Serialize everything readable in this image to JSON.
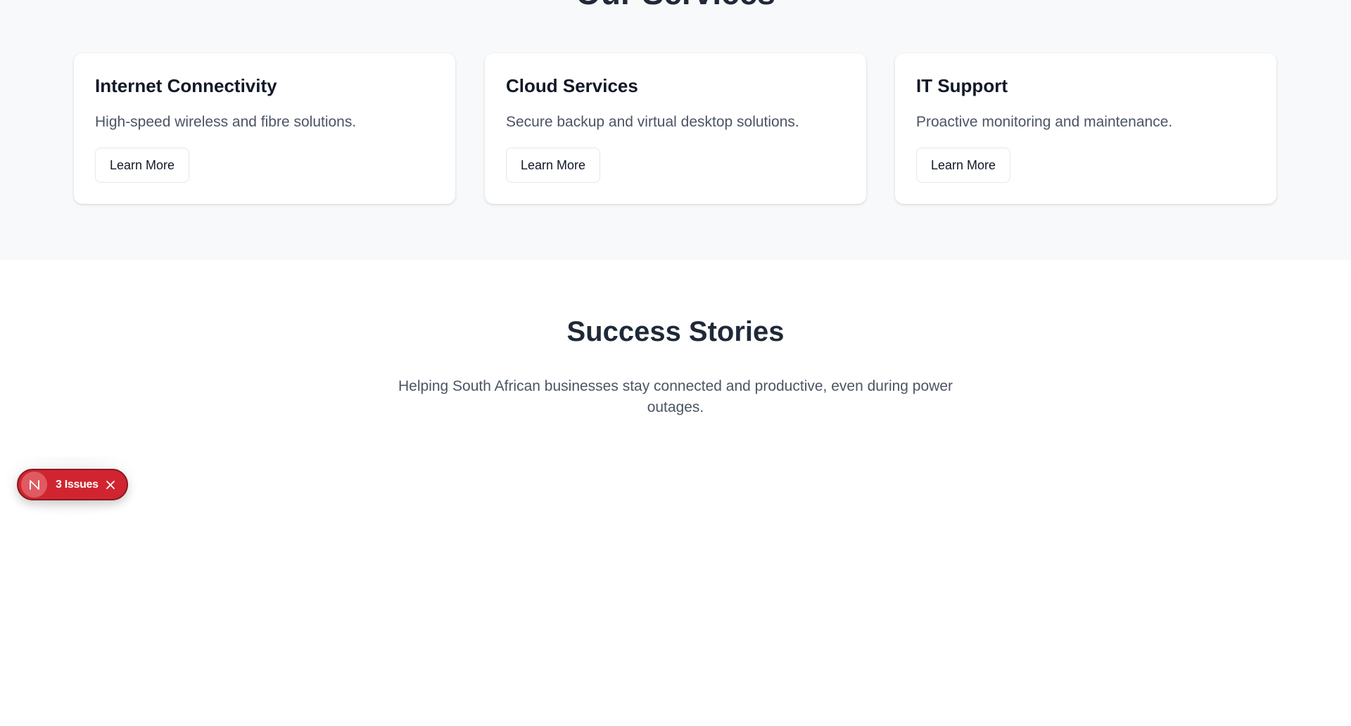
{
  "services": {
    "title": "Our Services",
    "cards": [
      {
        "title": "Internet Connectivity",
        "description": "High-speed wireless and fibre solutions.",
        "button_label": "Learn More"
      },
      {
        "title": "Cloud Services",
        "description": "Secure backup and virtual desktop solutions.",
        "button_label": "Learn More"
      },
      {
        "title": "IT Support",
        "description": "Proactive monitoring and maintenance.",
        "button_label": "Learn More"
      }
    ]
  },
  "stories": {
    "title": "Success Stories",
    "description": "Helping South African businesses stay connected and productive, even during power outages."
  },
  "dev_indicator": {
    "badge_letter": "N",
    "issues_label": "3 Issues",
    "colors": {
      "pill": "#d02530",
      "badge": "#e05a62",
      "text": "#ffffff"
    },
    "icons": [
      "nextjs-logo-icon",
      "close-icon"
    ]
  },
  "colors": {
    "services_background": "#f8f9fb",
    "page_background": "#ffffff",
    "heading": "#1f2937",
    "body_text": "#4b5563"
  }
}
